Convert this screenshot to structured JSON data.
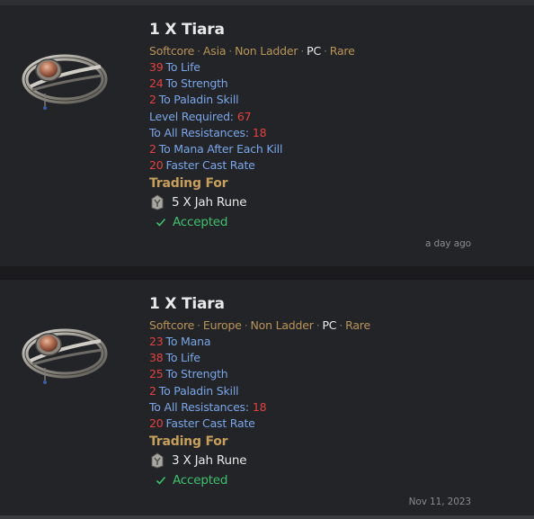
{
  "listings": [
    {
      "title": "1 X Tiara",
      "meta": {
        "mode": "Softcore",
        "region": "Asia",
        "ladder": "Non Ladder",
        "platform": "PC",
        "rarity": "Rare"
      },
      "stats": [
        {
          "value": "39",
          "label": "To Life"
        },
        {
          "value": "24",
          "label": "To Strength"
        },
        {
          "value": "2",
          "label": "To Paladin Skill"
        },
        {
          "label": "Level Required:",
          "value_after": "67"
        },
        {
          "label": "To All Resistances:",
          "value_after": "18"
        },
        {
          "value": "2",
          "label": "To Mana After Each Kill"
        },
        {
          "value": "20",
          "label": "Faster Cast Rate"
        }
      ],
      "trading_heading": "Trading For",
      "offer": "5 X Jah Rune",
      "offer_icon": "rune-icon",
      "status": "Accepted",
      "status_icon": "check-icon",
      "timestamp": "a day ago"
    },
    {
      "title": "1 X Tiara",
      "meta": {
        "mode": "Softcore",
        "region": "Europe",
        "ladder": "Non Ladder",
        "platform": "PC",
        "rarity": "Rare"
      },
      "stats": [
        {
          "value": "23",
          "label": "To Mana"
        },
        {
          "value": "38",
          "label": "To Life"
        },
        {
          "value": "25",
          "label": "To Strength"
        },
        {
          "value": "2",
          "label": "To Paladin Skill"
        },
        {
          "label": "To All Resistances:",
          "value_after": "18"
        },
        {
          "value": "20",
          "label": "Faster Cast Rate"
        }
      ],
      "trading_heading": "Trading For",
      "offer": "3 X Jah Rune",
      "offer_icon": "rune-icon",
      "status": "Accepted",
      "status_icon": "check-icon",
      "timestamp": "Nov 11, 2023"
    }
  ],
  "colors": {
    "background": "#232427",
    "title": "#e9e9ea",
    "meta": "#b8945a",
    "stat_label": "#7aa6e8",
    "stat_value": "#e34141",
    "trading_heading": "#c79f5c",
    "accepted": "#3ec06e",
    "timestamp": "#8a8a8c"
  },
  "item_image_icon": "tiara-item-icon"
}
